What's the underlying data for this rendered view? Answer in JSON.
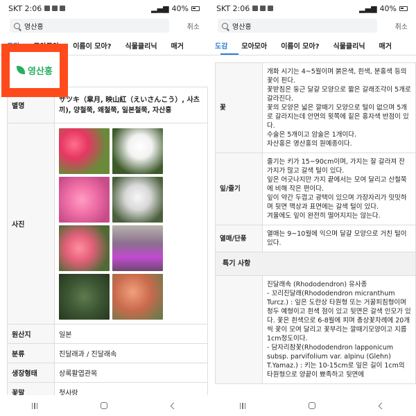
{
  "status": {
    "carrier_time": "SKT 2:06",
    "battery": "40%"
  },
  "search": {
    "query": "영산홍",
    "cancel": "취소"
  },
  "left": {
    "tabs": [
      "도감",
      "모아모아",
      "이름이 모아?",
      "식물클리닉",
      "매거"
    ],
    "title": "영산홍",
    "alias_label": "별명",
    "alias_value": "サツキ（皐月, 映山紅（えいさんこう）, 사츠끼), 양철쭉, 왜철쭉, 일본철쭉, 자산홍",
    "photo_label": "사진",
    "origin_label": "원산지",
    "origin_value": "일본",
    "class_label": "분류",
    "class_value": "진달래과 / 진달래속",
    "form_label": "생장형태",
    "form_value": "상록활엽관목",
    "flowerlang_label": "꽃말",
    "flowerlang_value": "첫사랑"
  },
  "right": {
    "tabs": [
      "도감",
      "모아모아",
      "이름이 모아?",
      "식물클리닉",
      "매거"
    ],
    "flower_label": "꽃",
    "flower_text": [
      "개화 시기는 4~5월이며 붉은색, 흰색, 분홍색 등의 꽃이 핀다.",
      "꽃받침은 둥근 달걀 모양으로 짧은 갈래조각이 5개로 갈라진다.",
      "꽃의 모양은 넓은 깔때기 모양으로 털이 없으며 5개로 갈라지는데 안면의 윗쪽에 짙은 홍자색 반점이 있다.",
      "수술은 5개이고 암술은 1개이다.",
      "자산홍은 영산홍의 원예종이다."
    ],
    "leaf_label": "잎/줄기",
    "leaf_text": [
      "줄기는 키가 15~90cm이며, 가지는 잘 갈라져 잔 가지가 많고 갈색 털이 있다.",
      "잎은 어긋나지만 가지 끝에서는 모여 달리고 산철쭉에 비해 작은 편이다.",
      "잎이 약간 두껍고 광택이 있으며 가장자리가 밋밋하며 뒷면 맥상과 표면에는 갈색 털이 있다.",
      "겨울에도 잎이 완전히 떨어지지는 않는다."
    ],
    "fruit_label": "열매/단풍",
    "fruit_text": "열매는 9~10월에 익으며 달걀 모양으로 거친 털이 있다.",
    "special_label": "특기 사항",
    "special_text": [
      "진달래속 (Rhododendron) 유사종",
      "- 꼬리진달래(Rhododendron micranthum Turcz.) : 잎은 도란상 타원형 또는 거꿀피침형이며 청두 예형이고 흰색 점이 있고 뒷면은 갈색 인모가 있다. 꽃은 흰색으로 6-8월에 피며 총상꽃차례에 20개씩 꽃이 모여 달리고 꽃부리는 깔때기모양이고 지름 1cm정도이다.",
      "- 담자리참꽃(Rhododendron lapponicum subsp. parvifolium var. alpinu (Glehn) T.Yamaz.) : 키는 10-15cm로 잎은 길이 1cm의 타원형으로 양끝이 뾰족하고 뒷면에"
    ]
  }
}
